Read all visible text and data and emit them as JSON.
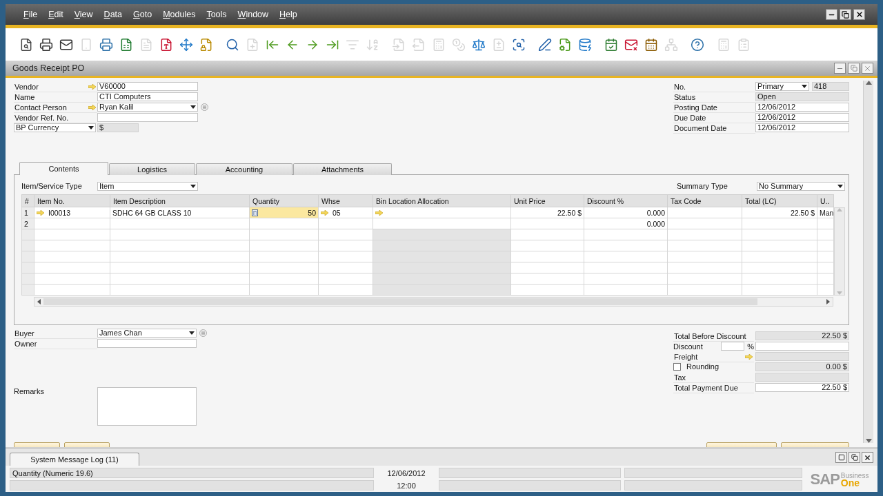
{
  "menu": [
    "File",
    "Edit",
    "View",
    "Data",
    "Goto",
    "Modules",
    "Tools",
    "Window",
    "Help"
  ],
  "toolbar": [
    {
      "disabled": false
    },
    {
      "disabled": false
    },
    {
      "disabled": false
    },
    {
      "disabled": true
    },
    {
      "disabled": false
    },
    {
      "disabled": false
    },
    {
      "disabled": true
    },
    {
      "disabled": false
    },
    {
      "disabled": false
    },
    {
      "disabled": false
    },
    {
      "disabled": false
    },
    {
      "disabled": true
    },
    {
      "disabled": false
    },
    {
      "disabled": false
    },
    {
      "disabled": false
    },
    {
      "disabled": false
    },
    {
      "disabled": true
    },
    {
      "disabled": true
    },
    {
      "disabled": true
    },
    {
      "disabled": true
    },
    {
      "disabled": true
    },
    {
      "disabled": true
    },
    {
      "disabled": false
    },
    {
      "disabled": true
    },
    {
      "disabled": false
    },
    {
      "disabled": false
    },
    {
      "disabled": false
    },
    {
      "disabled": false
    },
    {
      "disabled": false
    },
    {
      "disabled": false
    },
    {
      "disabled": false
    },
    {
      "disabled": true
    },
    {
      "disabled": false
    },
    {
      "disabled": true
    },
    {
      "disabled": true
    }
  ],
  "form": {
    "title": "Goods Receipt PO",
    "header_left": [
      {
        "label": "Vendor",
        "kind": "text",
        "value": "V60000",
        "link": true
      },
      {
        "label": "Name",
        "kind": "text",
        "value": "CTI Computers",
        "link": false
      },
      {
        "label": "Contact Person",
        "kind": "dropdown",
        "value": "Ryan Kalil",
        "link": true
      },
      {
        "label": "Vendor Ref. No.",
        "kind": "text",
        "link": false
      },
      {
        "label": "BP Currency",
        "kind": "currency",
        "value": "$",
        "link": false,
        "readonly": true
      }
    ],
    "header_right": [
      {
        "label": "No.",
        "kind": "series",
        "series": "Primary",
        "value": "418",
        "readonly": true
      },
      {
        "label": "Status",
        "kind": "text",
        "value": "Open",
        "readonly": true
      },
      {
        "label": "Posting Date",
        "kind": "text",
        "value": "12/06/2012",
        "readonly": false
      },
      {
        "label": "Due Date",
        "kind": "text",
        "value": "12/06/2012",
        "readonly": false
      },
      {
        "label": "Document Date",
        "kind": "text",
        "value": "12/06/2012",
        "readonly": false
      }
    ],
    "tabs": [
      {
        "label": "Contents",
        "selected": true
      },
      {
        "label": "Logistics",
        "selected": false
      },
      {
        "label": "Accounting",
        "selected": false
      },
      {
        "label": "Attachments",
        "selected": false
      }
    ],
    "item_type": {
      "label": "Item/Service Type",
      "value": "Item"
    },
    "summary_type": {
      "label": "Summary Type",
      "value": "No Summary"
    },
    "table": {
      "columns": [
        "#",
        "Item No.",
        "Item Description",
        "Quantity",
        "Whse",
        "Bin Location Allocation",
        "Unit Price",
        "Discount %",
        "Tax Code",
        "Total (LC)",
        "U.."
      ],
      "rows": [
        {
          "number": "1",
          "focused": true,
          "item_no": "I00013",
          "description": "SDHC 64 GB CLASS 10",
          "quantity": "50",
          "whse": "05",
          "unit_price": "22.50 $",
          "discount": "0.000",
          "total": "22.50 $",
          "uom": "Man"
        },
        {
          "number": "2",
          "focused": false,
          "discount": "0.000"
        }
      ]
    },
    "footer_left": [
      {
        "label": "Buyer",
        "kind": "dropdown",
        "value": "James Chan"
      },
      {
        "label": "Owner",
        "kind": "text"
      }
    ],
    "remarks": {
      "label": "Remarks"
    },
    "totals": [
      {
        "label": "Total Before Discount",
        "kind": "text",
        "value": "22.50 $",
        "readonly": true
      },
      {
        "label": "Discount",
        "kind": "percent",
        "unit": "%",
        "readonly": false
      },
      {
        "label": "Freight",
        "kind": "link",
        "readonly": true
      },
      {
        "label": "Rounding",
        "kind": "checkbox",
        "checked": false,
        "value": "0.00 $",
        "readonly": true
      },
      {
        "label": "Tax",
        "kind": "text",
        "readonly": true
      },
      {
        "label": "Total Payment Due",
        "kind": "text",
        "value": "22.50 $",
        "readonly": false
      }
    ]
  },
  "message_log": {
    "tab": "System Message Log (11)"
  },
  "status_bar": {
    "message": "Quantity (Numeric 19.6)",
    "date": "12/06/2012",
    "time": "12:00"
  },
  "logo": {
    "brand": "SAP",
    "line1": "Business",
    "line2": "One"
  }
}
